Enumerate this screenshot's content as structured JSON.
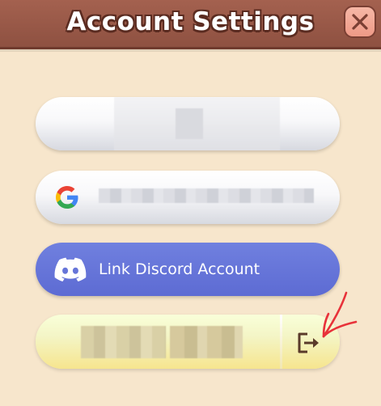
{
  "header": {
    "title": "Account Settings",
    "close_icon": "close-x-icon"
  },
  "accounts": {
    "guest_row": {
      "redacted": true
    },
    "google_row": {
      "icon": "google-icon",
      "redacted": true
    },
    "discord_row": {
      "icon": "discord-icon",
      "label": "Link Discord Account"
    },
    "logout_row": {
      "redacted": true,
      "logout_icon": "logout-icon"
    }
  },
  "annotation": {
    "icon": "red-arrow-annotation"
  },
  "colors": {
    "background": "#f7e6cc",
    "header": "#9a5a49",
    "close_button": "#f2a796",
    "discord": "#6574d8",
    "logout_pill": "#f6e58e",
    "annotation": "#e8323a"
  }
}
